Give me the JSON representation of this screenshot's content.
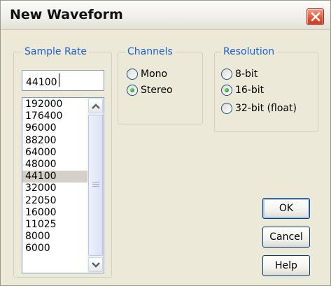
{
  "window": {
    "title": "New Waveform",
    "accent": "#1d5fcf",
    "close_color": "#e0583c"
  },
  "sample_rate": {
    "legend": "Sample Rate",
    "input_value": "44100",
    "items": [
      "192000",
      "176400",
      "96000",
      "88200",
      "64000",
      "48000",
      "44100",
      "32000",
      "22050",
      "16000",
      "11025",
      "8000",
      "6000"
    ],
    "selected": "44100"
  },
  "channels": {
    "legend": "Channels",
    "options": [
      {
        "label": "Mono",
        "checked": false
      },
      {
        "label": "Stereo",
        "checked": true
      }
    ]
  },
  "resolution": {
    "legend": "Resolution",
    "options": [
      {
        "label": "8-bit",
        "checked": false
      },
      {
        "label": "16-bit",
        "checked": true
      },
      {
        "label": "32-bit (float)",
        "checked": false
      }
    ]
  },
  "buttons": {
    "ok": "OK",
    "cancel": "Cancel",
    "help": "Help"
  },
  "icons": {
    "close": "close-icon",
    "scroll_up": "chevron-up-icon",
    "scroll_down": "chevron-down-icon",
    "grip": "grip-icon"
  }
}
